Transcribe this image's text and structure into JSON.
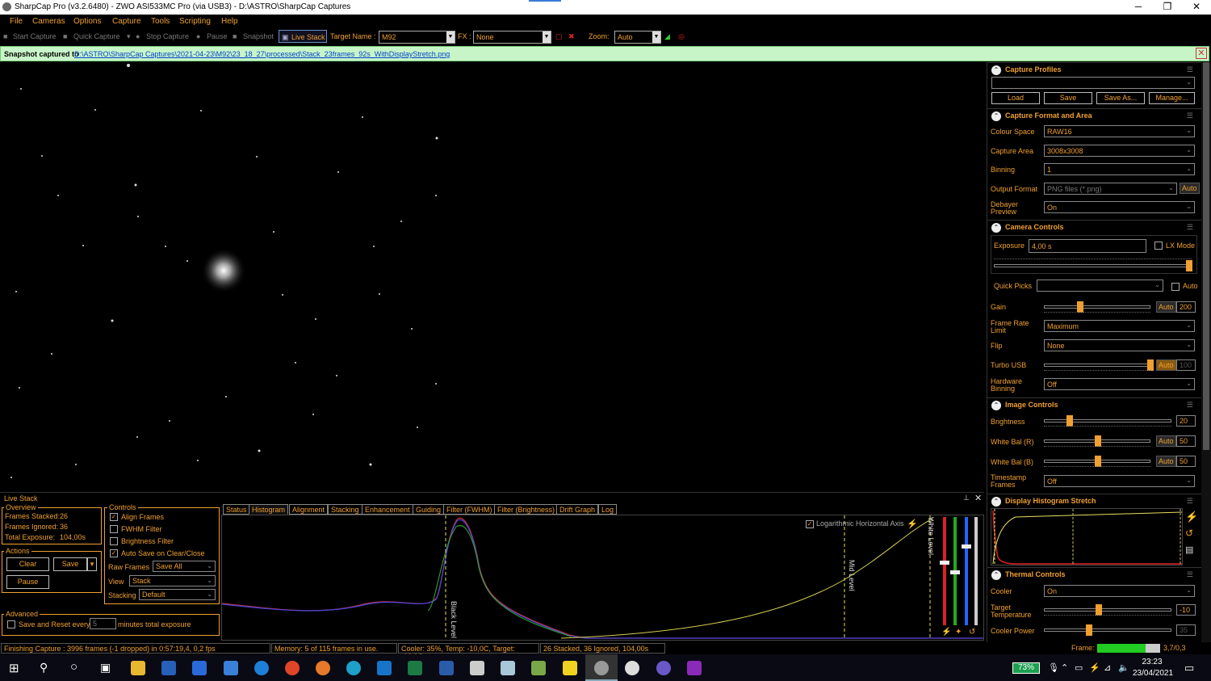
{
  "window": {
    "title": "SharpCap Pro (v3.2.6480) - ZWO ASI533MC Pro (via USB3) - D:\\ASTRO\\SharpCap Captures",
    "minimize": "─",
    "restore": "❐",
    "close": "✕"
  },
  "menu": [
    "File",
    "Cameras",
    "Options",
    "Capture",
    "Tools",
    "Scripting",
    "Help"
  ],
  "toolbar": {
    "start_capture": "Start Capture",
    "quick_capture": "Quick Capture",
    "stop_capture": "Stop Capture",
    "pause": "Pause",
    "snapshot": "Snapshot",
    "live_stack": "Live Stack",
    "target_label": "Target Name :",
    "target_value": "M92",
    "fx_label": "FX :",
    "fx_value": "None",
    "zoom_label": "Zoom:",
    "zoom_value": "Auto"
  },
  "notification": {
    "prefix": "Snapshot captured to",
    "path": "D:\\ASTRO\\SharpCap Captures\\2021-04-23\\M92\\23_18_27\\processed\\Stack_23frames_92s_WithDisplayStretch.png"
  },
  "capture_profiles": {
    "title": "Capture Profiles",
    "selected": "",
    "load": "Load",
    "save": "Save",
    "save_as": "Save As...",
    "manage": "Manage..."
  },
  "capture_format": {
    "title": "Capture Format and Area",
    "colour_space_label": "Colour Space",
    "colour_space": "RAW16",
    "capture_area_label": "Capture Area",
    "capture_area": "3008x3008",
    "binning_label": "Binning",
    "binning": "1",
    "output_format_label": "Output Format",
    "output_format": "PNG files (*.png)",
    "output_auto": "Auto",
    "debayer_label": "Debayer Preview",
    "debayer": "On"
  },
  "camera_controls": {
    "title": "Camera Controls",
    "exposure_label": "Exposure",
    "exposure": "4,00 s",
    "lx_mode": "LX Mode",
    "quick_picks_label": "Quick Picks",
    "quick_picks": "",
    "quick_auto": "Auto",
    "gain_label": "Gain",
    "gain_auto": "Auto",
    "gain": "200",
    "frame_rate_label": "Frame Rate Limit",
    "frame_rate": "Maximum",
    "flip_label": "Flip",
    "flip": "None",
    "turbo_label": "Turbo USB",
    "turbo_auto": "Auto",
    "turbo": "100",
    "hw_binning_label": "Hardware Binning",
    "hw_binning": "Off"
  },
  "image_controls": {
    "title": "Image Controls",
    "brightness_label": "Brightness",
    "brightness": "20",
    "wb_r_label": "White Bal (R)",
    "wb_r_auto": "Auto",
    "wb_r": "50",
    "wb_b_label": "White Bal (B)",
    "wb_b_auto": "Auto",
    "wb_b": "50",
    "timestamp_label": "Timestamp Frames",
    "timestamp": "Off"
  },
  "display_stretch": {
    "title": "Display Histogram Stretch"
  },
  "thermal": {
    "title": "Thermal Controls",
    "cooler_label": "Cooler",
    "cooler": "On",
    "target_label": "Target Temperature",
    "target": "-10",
    "power_label": "Cooler Power",
    "power": "35"
  },
  "live_stack": {
    "title": "Live Stack",
    "overview_title": "Overview",
    "frames_stacked_label": "Frames Stacked:",
    "frames_stacked": "26",
    "frames_ignored_label": "Frames Ignored:",
    "frames_ignored": "36",
    "total_exposure_label": "Total Exposure:",
    "total_exposure": "104,00s",
    "actions_title": "Actions",
    "clear": "Clear",
    "save": "Save",
    "pause": "Pause",
    "controls_title": "Controls",
    "align_frames": "Align Frames",
    "fwhm_filter": "FWHM Filter",
    "brightness_filter": "Brightness Filter",
    "auto_save": "Auto Save on Clear/Close",
    "raw_frames_label": "Raw Frames",
    "raw_frames": "Save All",
    "view_label": "View",
    "view": "Stack",
    "stacking_label": "Stacking",
    "stacking": "Default",
    "advanced_title": "Advanced",
    "save_reset_label": "Save and Reset every",
    "save_reset_value": "5",
    "save_reset_suffix": "minutes total exposure",
    "tabs": [
      "Status",
      "Histogram",
      "Alignment",
      "Stacking",
      "Enhancement",
      "Guiding",
      "Filter (FWHM)",
      "Filter (Brightness)",
      "Drift Graph",
      "Log"
    ],
    "log_axis": "Logarithmic Horizontal Axis",
    "black_level": "Black Level",
    "mid_level": "Mid Level",
    "white_level": "White Level"
  },
  "status": {
    "capture": "Finishing Capture : 3996 frames (-1 dropped) in 0:57:19,4, 0,2 fps",
    "memory": "Memory: 5 of 115 frames in use.",
    "cooler": "Cooler: 35%, Temp: -10,0C, Target: -10,0C",
    "stack": "26 Stacked, 36 Ignored, 104,00s",
    "frame_label": "Frame:",
    "frame_value": "3,7/0,3"
  },
  "taskbar": {
    "battery": "73%",
    "time": "23:23",
    "date": "23/04/2021"
  },
  "colors": {
    "accent": "#f0a030",
    "background": "#000000",
    "notification_bg": "#c8f5c8",
    "link": "#0044cc"
  }
}
